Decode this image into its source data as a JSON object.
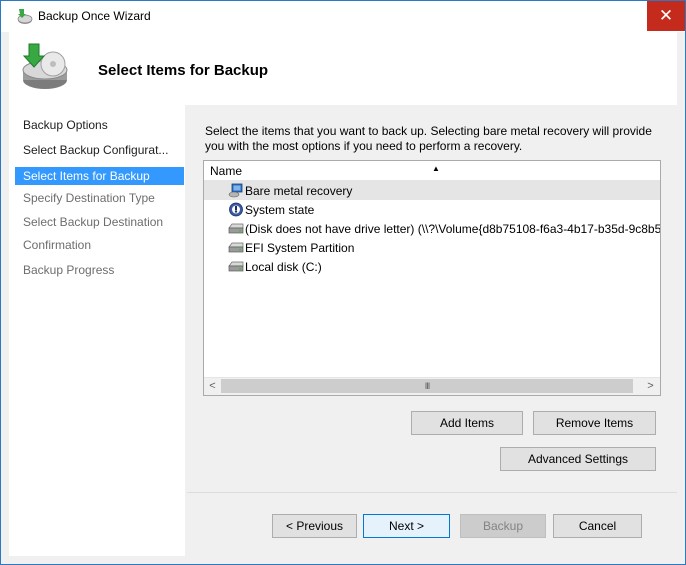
{
  "window": {
    "title": "Backup Once Wizard",
    "close_glyph": "✕"
  },
  "header": {
    "title": "Select Items for Backup",
    "icon": "backup-disk-icon"
  },
  "sidebar": {
    "items": [
      {
        "label": "Backup Options",
        "state": "done"
      },
      {
        "label": "Select Backup Configurat...",
        "state": "done"
      },
      {
        "label": "Select Items for Backup",
        "state": "current"
      },
      {
        "label": "Specify Destination Type",
        "state": "pending"
      },
      {
        "label": "Select Backup Destination",
        "state": "pending"
      },
      {
        "label": "Confirmation",
        "state": "pending"
      },
      {
        "label": "Backup Progress",
        "state": "pending"
      }
    ]
  },
  "main": {
    "instruction": "Select the items that you want to back up. Selecting bare metal recovery will provide you with the most options if you need to perform a recovery.",
    "list": {
      "column_header": "Name",
      "sort_glyph": "▲",
      "items": [
        {
          "label": "Bare metal recovery",
          "icon": "bare-metal-icon",
          "selected": true
        },
        {
          "label": "System state",
          "icon": "system-state-icon",
          "selected": false
        },
        {
          "label": "(Disk does not have drive letter) (\\\\?\\Volume{d8b75108-f6a3-4b17-b35d-9c8b5.",
          "icon": "drive-icon",
          "selected": false
        },
        {
          "label": "EFI System Partition",
          "icon": "drive-icon",
          "selected": false
        },
        {
          "label": "Local disk (C:)",
          "icon": "drive-icon",
          "selected": false
        }
      ],
      "scroll_left_glyph": "<",
      "scroll_right_glyph": ">",
      "scroll_grip_glyph": "III"
    },
    "buttons": {
      "add_items": "Add Items",
      "remove_items": "Remove Items",
      "advanced_settings": "Advanced Settings"
    }
  },
  "footer": {
    "previous": "< Previous",
    "next": "Next >",
    "backup": "Backup",
    "cancel": "Cancel"
  },
  "colors": {
    "selection": "#3399ff",
    "close": "#c42b1c",
    "frame": "#2b79c2"
  }
}
